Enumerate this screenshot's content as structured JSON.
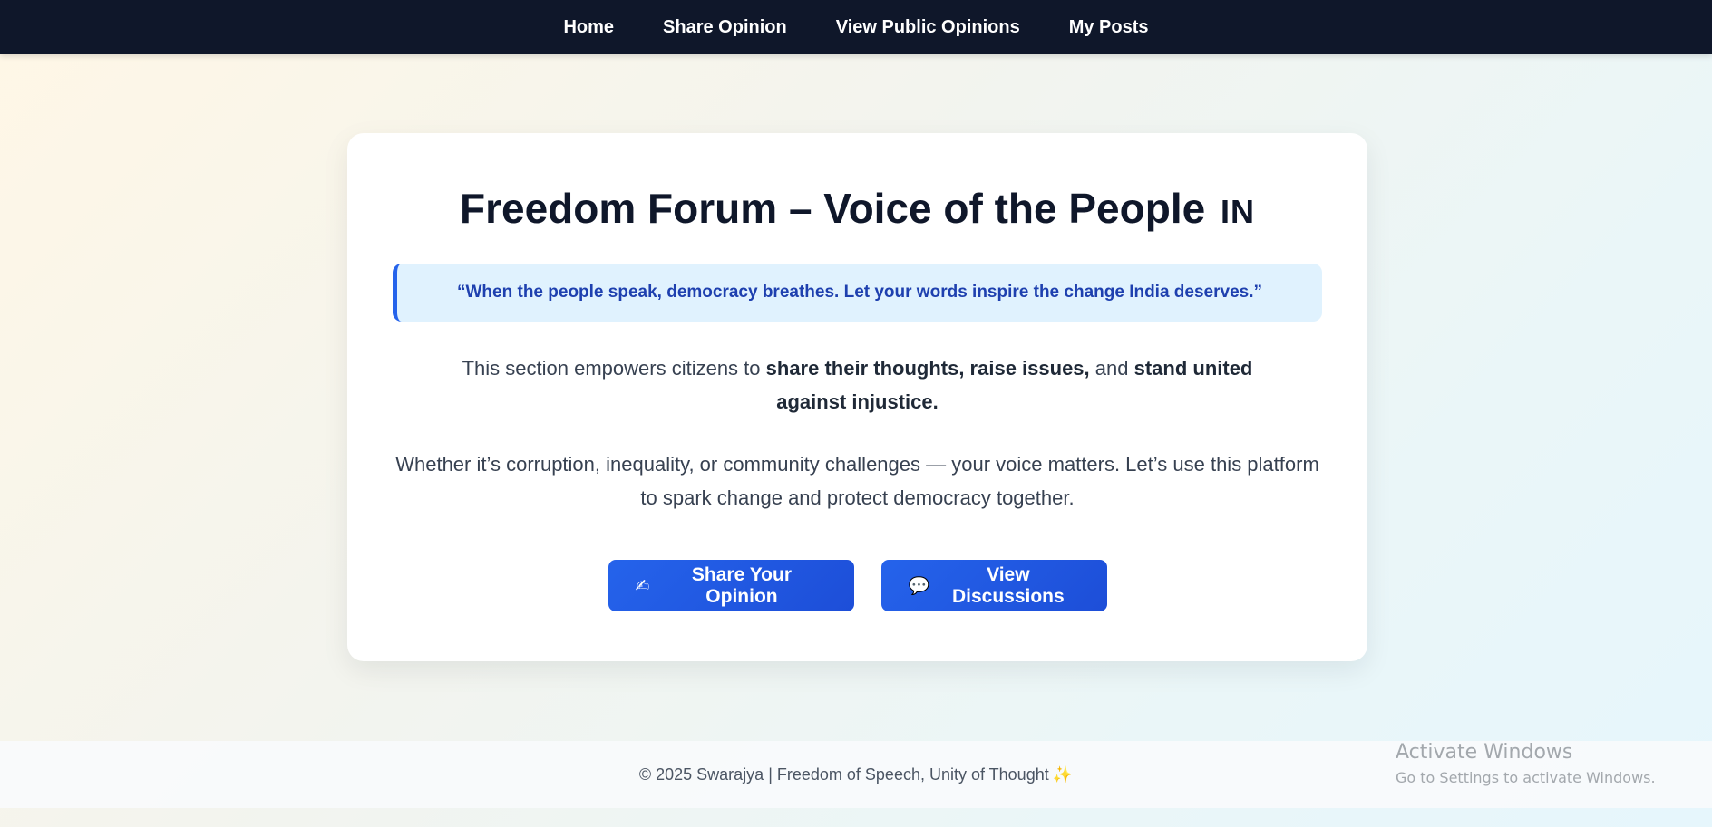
{
  "nav": {
    "items": [
      {
        "label": "Home"
      },
      {
        "label": "Share Opinion"
      },
      {
        "label": "View Public Opinions"
      },
      {
        "label": "My Posts"
      }
    ]
  },
  "hero": {
    "title": "Freedom Forum – Voice of the People",
    "flag_code": "IN",
    "quote": "“When the people speak, democracy breathes. Let your words inspire the change India deserves.”",
    "para1": {
      "intro": "This section empowers citizens to ",
      "bold1": "share their thoughts, raise issues,",
      "mid": " and ",
      "bold2": "stand united against injustice."
    },
    "para2": "Whether it’s corruption, inequality, or community challenges — your voice matters. Let’s use this platform to spark change and protect democracy together."
  },
  "buttons": {
    "share": {
      "emoji": "✍",
      "label": "Share Your Opinion"
    },
    "view": {
      "emoji": "💬",
      "label": "View Discussions"
    }
  },
  "footer": {
    "text": "© 2025 Swarajya | Freedom of Speech, Unity of Thought",
    "emoji": "✨"
  },
  "watermark": {
    "title": "Activate Windows",
    "subtitle": "Go to Settings to activate Windows."
  },
  "colors": {
    "nav_bg": "#0f172a",
    "accent": "#2563eb",
    "quote_bg": "#e0f2fe",
    "quote_text": "#1e40af"
  }
}
